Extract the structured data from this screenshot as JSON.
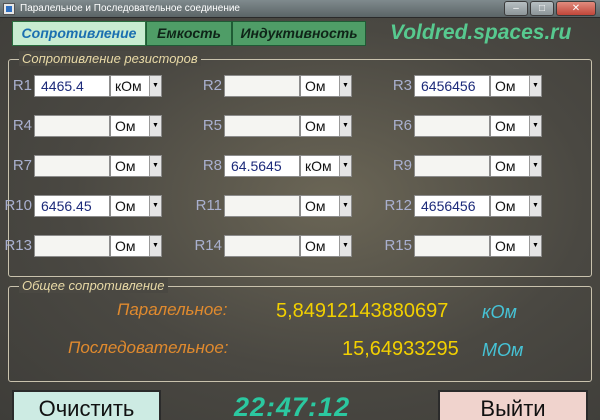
{
  "window": {
    "title": "Паралельное и Последовательное соединение"
  },
  "tabs": [
    "Сопротивление",
    "Емкость",
    "Индуктивность"
  ],
  "brand": "Voldred.spaces.ru",
  "resistors_group": {
    "title": "Сопротивление резисторов"
  },
  "resistors": [
    {
      "label": "R1",
      "value": "4465.4",
      "unit": "кОм"
    },
    {
      "label": "R2",
      "value": "",
      "unit": "Ом"
    },
    {
      "label": "R3",
      "value": "6456456",
      "unit": "Ом"
    },
    {
      "label": "R4",
      "value": "",
      "unit": "Ом"
    },
    {
      "label": "R5",
      "value": "",
      "unit": "Ом"
    },
    {
      "label": "R6",
      "value": "",
      "unit": "Ом"
    },
    {
      "label": "R7",
      "value": "",
      "unit": "Ом"
    },
    {
      "label": "R8",
      "value": "64.5645",
      "unit": "кОм"
    },
    {
      "label": "R9",
      "value": "",
      "unit": "Ом"
    },
    {
      "label": "R10",
      "value": "6456.45",
      "unit": "Ом"
    },
    {
      "label": "R11",
      "value": "",
      "unit": "Ом"
    },
    {
      "label": "R12",
      "value": "4656456",
      "unit": "Ом"
    },
    {
      "label": "R13",
      "value": "",
      "unit": "Ом"
    },
    {
      "label": "R14",
      "value": "",
      "unit": "Ом"
    },
    {
      "label": "R15",
      "value": "",
      "unit": "Ом"
    }
  ],
  "total_group": {
    "title": "Общее сопротивление"
  },
  "total": {
    "parallel": {
      "label": "Паралельное:",
      "value": "5,84912143880697",
      "unit": "кОм"
    },
    "sequential": {
      "label": "Последовательное:",
      "value": "15,64933295",
      "unit": "МОм"
    }
  },
  "buttons": {
    "clear": "Очистить",
    "exit": "Выйти"
  },
  "clock": "22:47:12",
  "colors": {
    "tab_active": "#c8ecd1",
    "tab": "#4f9d67",
    "value_yellow": "#f2d000",
    "unit_cyan": "#46c3d6",
    "label_orange": "#e08a2e"
  }
}
